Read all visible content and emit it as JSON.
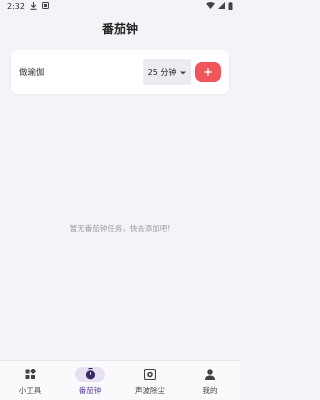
{
  "status_bar": {
    "time": "2:32",
    "icons": [
      "download-icon",
      "notification-icon",
      "wifi-icon",
      "signal-icon",
      "battery-icon"
    ]
  },
  "header": {
    "title": "番茄钟"
  },
  "task_form": {
    "input_value": "做瑜伽",
    "duration_label": "25 分钟",
    "add_icon": "plus-icon",
    "colors": {
      "accent": "#f0565b"
    }
  },
  "empty_state": {
    "message": "暂无番茄钟任务，快去添加吧!"
  },
  "bottom_nav": {
    "items": [
      {
        "label": "小工具",
        "icon": "widgets-icon",
        "active": false
      },
      {
        "label": "番茄钟",
        "icon": "timer-icon",
        "active": true
      },
      {
        "label": "声波除尘",
        "icon": "speaker-icon",
        "active": false
      },
      {
        "label": "我的",
        "icon": "person-icon",
        "active": false
      }
    ],
    "colors": {
      "active": "#5a3fa0",
      "active_pill": "#e7e0f3"
    }
  }
}
